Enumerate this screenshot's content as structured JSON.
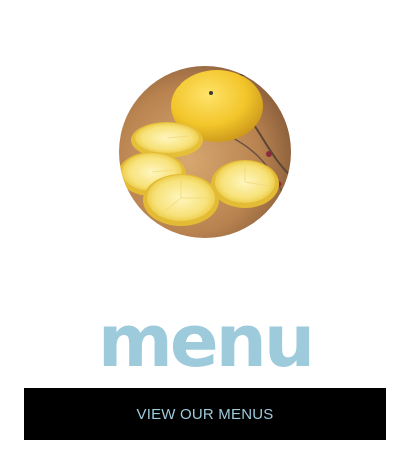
{
  "hero": {
    "image_subject": "lemons-photo"
  },
  "section": {
    "heading": "menu"
  },
  "cta": {
    "label": "VIEW OUR MENUS"
  },
  "colors": {
    "accent": "#9ecbdb",
    "button_bg": "#000000",
    "background": "#ffffff"
  }
}
